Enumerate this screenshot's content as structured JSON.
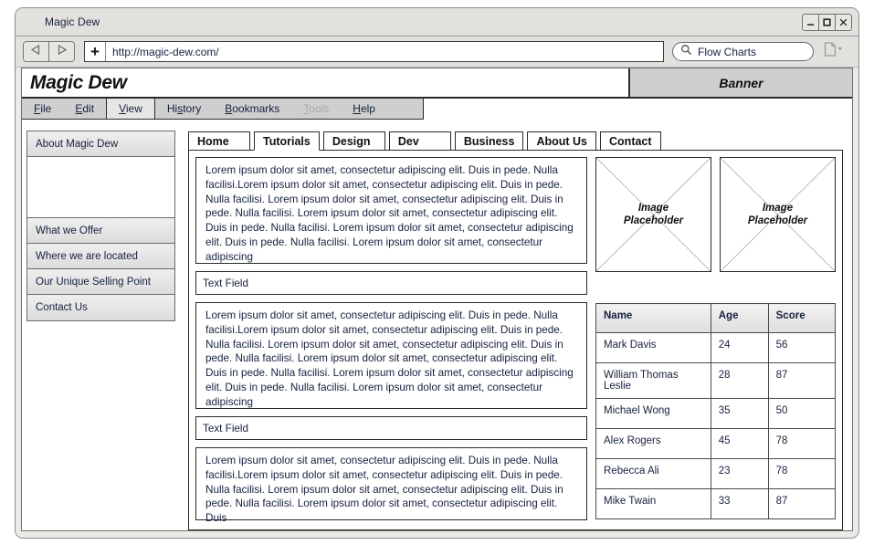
{
  "window": {
    "title": "Magic Dew",
    "controls": [
      {
        "name": "minimize",
        "glyph": "minimize-icon"
      },
      {
        "name": "maximize",
        "glyph": "maximize-icon"
      },
      {
        "name": "close",
        "glyph": "close-icon"
      }
    ]
  },
  "toolbar": {
    "back_icon": "back-arrow-icon",
    "forward_icon": "forward-arrow-icon",
    "plus_label": "+",
    "url": "http://magic-dew.com/",
    "search_icon": "search-icon",
    "search_value": "Flow Charts",
    "page_icon": "page-dropdown-icon"
  },
  "site": {
    "logo": "Magic Dew",
    "banner": "Banner"
  },
  "menubar": {
    "items": [
      {
        "label": "File",
        "mnemonic": "F",
        "state": "normal"
      },
      {
        "label": "Edit",
        "mnemonic": "E",
        "state": "normal"
      },
      {
        "label": "View",
        "mnemonic": "V",
        "state": "active"
      },
      {
        "label": "History",
        "mnemonic": "H",
        "state": "normal"
      },
      {
        "label": "Bookmarks",
        "mnemonic": "B",
        "state": "normal"
      },
      {
        "label": "Tools",
        "mnemonic": "T",
        "state": "disabled"
      },
      {
        "label": "Help",
        "mnemonic": "H",
        "state": "normal"
      }
    ]
  },
  "sidebar": {
    "items": [
      {
        "label": "About Magic Dew",
        "expanded": true
      },
      {
        "label": "What we Offer",
        "expanded": false
      },
      {
        "label": "Where we are located",
        "expanded": false
      },
      {
        "label": "Our Unique Selling Point",
        "expanded": false
      },
      {
        "label": "Contact Us",
        "expanded": false
      }
    ]
  },
  "tabs": [
    {
      "label": "Home",
      "active": false
    },
    {
      "label": "Tutorials",
      "active": true
    },
    {
      "label": "Design",
      "active": false
    },
    {
      "label": "Dev",
      "active": false
    },
    {
      "label": "Business",
      "active": false
    },
    {
      "label": "About Us",
      "active": false
    },
    {
      "label": "Contact",
      "active": false
    }
  ],
  "content": {
    "paragraph_1": "Lorem ipsum dolor sit amet, consectetur adipiscing elit. Duis in pede. Nulla facilisi.Lorem ipsum dolor sit amet, consectetur adipiscing elit. Duis in pede. Nulla facilisi. Lorem ipsum dolor sit amet, consectetur adipiscing elit. Duis in pede. Nulla facilisi. Lorem ipsum dolor sit amet, consectetur adipiscing elit. Duis in pede. Nulla facilisi. Lorem ipsum dolor sit amet, consectetur adipiscing elit. Duis in pede. Nulla facilisi. Lorem ipsum dolor sit amet, consectetur adipiscing",
    "text_field_1": "Text Field",
    "paragraph_2": "Lorem ipsum dolor sit amet, consectetur adipiscing elit. Duis in pede. Nulla facilisi.Lorem ipsum dolor sit amet, consectetur adipiscing elit. Duis in pede. Nulla facilisi. Lorem ipsum dolor sit amet, consectetur adipiscing elit. Duis in pede. Nulla facilisi. Lorem ipsum dolor sit amet, consectetur adipiscing elit. Duis in pede. Nulla facilisi. Lorem ipsum dolor sit amet, consectetur adipiscing elit. Duis in pede. Nulla facilisi. Lorem ipsum dolor sit amet, consectetur adipiscing",
    "text_field_2": "Text Field",
    "paragraph_3": "Lorem ipsum dolor sit amet, consectetur adipiscing elit. Duis in pede. Nulla facilisi.Lorem ipsum dolor sit amet, consectetur adipiscing elit. Duis in pede. Nulla facilisi. Lorem ipsum dolor sit amet, consectetur adipiscing elit. Duis in pede. Nulla facilisi. Lorem ipsum dolor sit amet, consectetur adipiscing elit. Duis",
    "image_placeholders": [
      {
        "line1": "Image",
        "line2": "Placeholder"
      },
      {
        "line1": "Image",
        "line2": "Placeholder"
      }
    ]
  },
  "table": {
    "headers": [
      "Name",
      "Age",
      "Score"
    ],
    "rows": [
      {
        "name": "Mark Davis",
        "age": "24",
        "score": "56"
      },
      {
        "name": "William Thomas Leslie",
        "age": "28",
        "score": "87"
      },
      {
        "name": "Michael Wong",
        "age": "35",
        "score": "50"
      },
      {
        "name": "Alex Rogers",
        "age": "45",
        "score": "78"
      },
      {
        "name": "Rebecca Ali",
        "age": "23",
        "score": "78"
      },
      {
        "name": "Mike Twain",
        "age": "33",
        "score": "87"
      }
    ]
  }
}
